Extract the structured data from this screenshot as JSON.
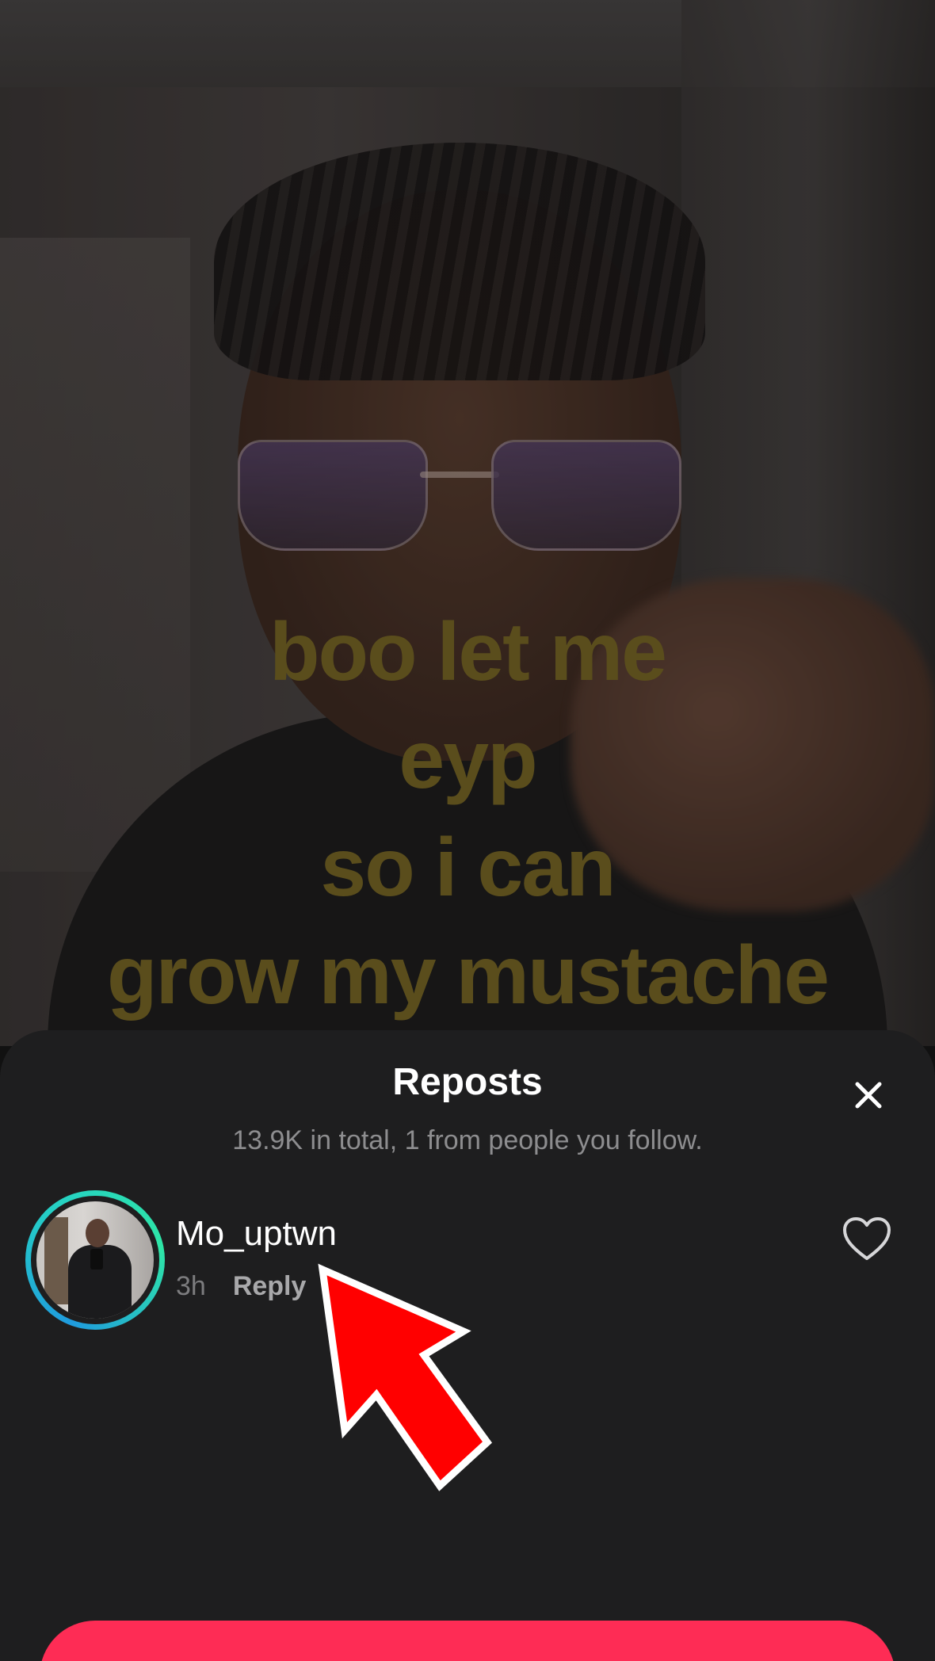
{
  "video": {
    "caption_lines": [
      "boo let me",
      "eyp",
      "so i can",
      "grow my mustache"
    ]
  },
  "sheet": {
    "title": "Reposts",
    "subtitle": "13.9K in total, 1 from people you follow.",
    "close_icon": "close-icon"
  },
  "reposts": [
    {
      "username": "Mo_uptwn",
      "time": "3h",
      "reply_label": "Reply",
      "like_icon": "heart-outline-icon"
    }
  ],
  "colors": {
    "sheet_bg": "#1e1e1f",
    "cta": "#fe2c55",
    "caption": "#5a4d1c",
    "annotation_arrow": "#ff0000"
  }
}
